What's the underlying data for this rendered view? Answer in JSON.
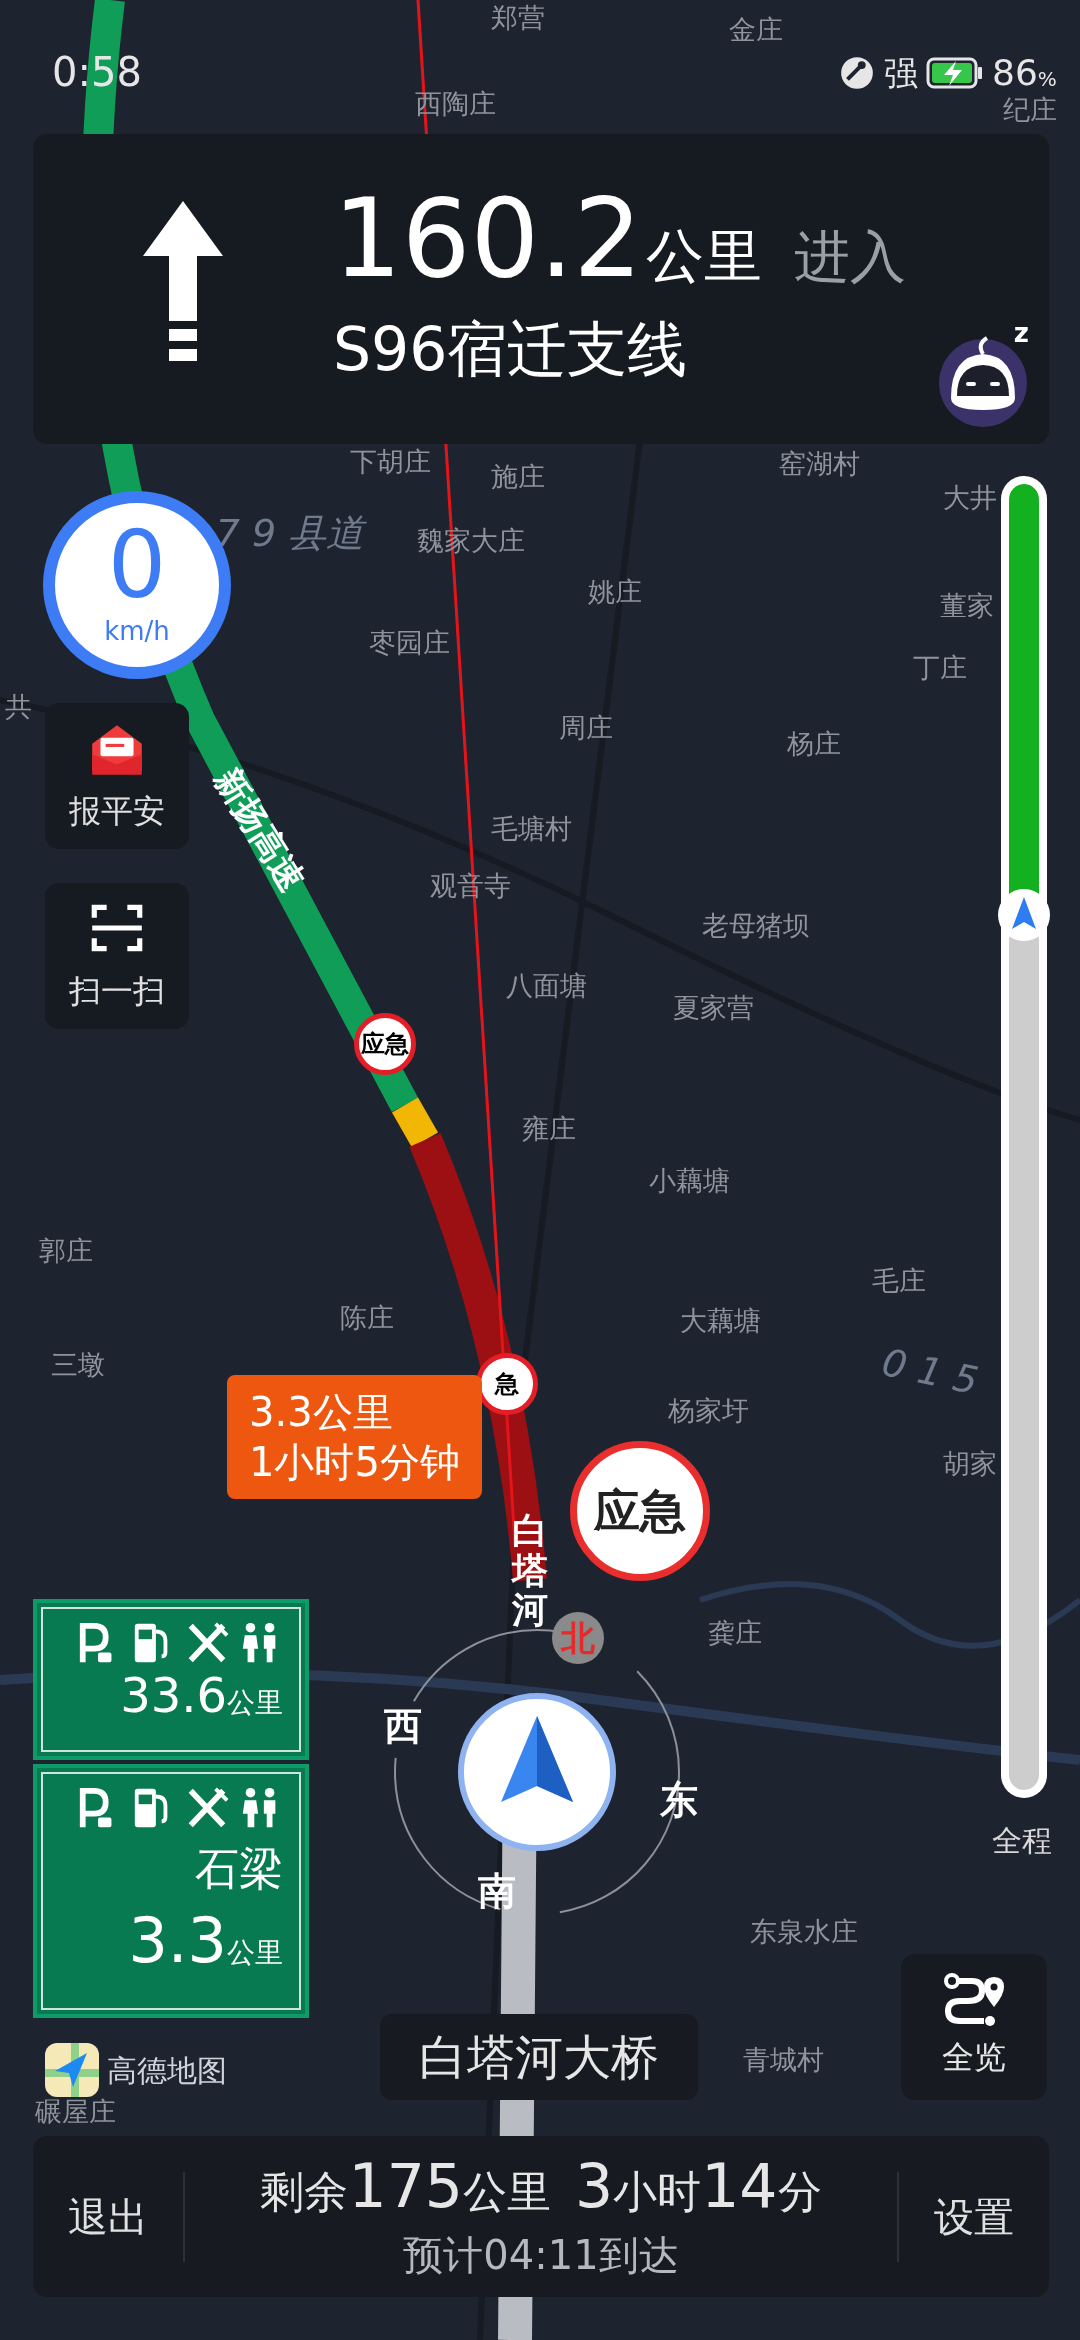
{
  "status_bar": {
    "time": "0:58",
    "signal_label": "强",
    "battery_value": "86",
    "battery_unit": "%",
    "charging": true
  },
  "guidance": {
    "arrow": {
      "kind": "straight"
    },
    "distance": "160.2",
    "unit": "公里",
    "action": "进入",
    "road": "S96宿迁支线",
    "assistant_badge": "z"
  },
  "speed": {
    "value": "0",
    "unit": "km/h"
  },
  "side_buttons": [
    {
      "kind": "safety",
      "label": "报平安"
    },
    {
      "kind": "scan",
      "label": "扫一扫"
    }
  ],
  "map_labels": [
    {
      "text": "郑营",
      "kind": "place"
    },
    {
      "text": "金庄",
      "kind": "place"
    },
    {
      "text": "西陶庄",
      "kind": "place"
    },
    {
      "text": "纪庄",
      "kind": "place"
    },
    {
      "text": "下胡庄",
      "kind": "place"
    },
    {
      "text": "施庄",
      "kind": "place"
    },
    {
      "text": "窑湖村",
      "kind": "place"
    },
    {
      "text": "大井",
      "kind": "place"
    },
    {
      "text": "7 9 县道",
      "kind": "road"
    },
    {
      "text": "魏家大庄",
      "kind": "place"
    },
    {
      "text": "姚庄",
      "kind": "place"
    },
    {
      "text": "董家",
      "kind": "place"
    },
    {
      "text": "枣园庄",
      "kind": "place"
    },
    {
      "text": "丁庄",
      "kind": "place"
    },
    {
      "text": "共",
      "kind": "place"
    },
    {
      "text": "周庄",
      "kind": "place"
    },
    {
      "text": "杨庄",
      "kind": "place"
    },
    {
      "text": "毛塘村",
      "kind": "place"
    },
    {
      "text": "观音寺",
      "kind": "place"
    },
    {
      "text": "老母猪坝",
      "kind": "place"
    },
    {
      "text": "八面塘",
      "kind": "place"
    },
    {
      "text": "夏家营",
      "kind": "place"
    },
    {
      "text": "雍庄",
      "kind": "place"
    },
    {
      "text": "小藕塘",
      "kind": "place"
    },
    {
      "text": "郭庄",
      "kind": "place"
    },
    {
      "text": "毛庄",
      "kind": "place"
    },
    {
      "text": "陈庄",
      "kind": "place"
    },
    {
      "text": "大藕塘",
      "kind": "place"
    },
    {
      "text": "三墩",
      "kind": "place"
    },
    {
      "text": "0 1 5",
      "kind": "road"
    },
    {
      "text": "杨家圩",
      "kind": "place"
    },
    {
      "text": "胡家",
      "kind": "place"
    },
    {
      "text": "龚庄",
      "kind": "place"
    },
    {
      "text": "东泉水庄",
      "kind": "place"
    },
    {
      "text": "青城村",
      "kind": "place"
    },
    {
      "text": "碾屋庄",
      "kind": "place"
    }
  ],
  "route_labels": [
    {
      "text": "新扬高速",
      "kind": "slanted"
    },
    {
      "text": "白塔河",
      "kind": "vertical"
    }
  ],
  "route_progress": {
    "level": 0.33,
    "label": "全程"
  },
  "emergency_markers": [
    {
      "text": "应急"
    },
    {
      "text": "急"
    }
  ],
  "traffic_bubble": {
    "distance": "3.3公里",
    "duration": "1小时5分钟"
  },
  "emergency_bubble": {
    "text": "应急"
  },
  "compass": {
    "north": "北",
    "west": "西",
    "east": "东",
    "south": "南"
  },
  "service_areas": [
    {
      "facilities": [
        {
          "kind": "parking"
        },
        {
          "kind": "fuel"
        },
        {
          "kind": "food"
        },
        {
          "kind": "restroom"
        }
      ],
      "distance": "33.6",
      "unit": "公里"
    },
    {
      "facilities": [
        {
          "kind": "parking"
        },
        {
          "kind": "fuel"
        },
        {
          "kind": "food"
        },
        {
          "kind": "restroom"
        }
      ],
      "name": "石梁",
      "distance": "3.3",
      "unit": "公里"
    }
  ],
  "brand": "高德地图",
  "current_road": "白塔河大桥",
  "overview_button": {
    "label": "全览"
  },
  "bottom_bar": {
    "exit": "退出",
    "remaining_distance": [
      {
        "text": "剩余",
        "kind": "small"
      },
      {
        "text": "175",
        "kind": "big"
      },
      {
        "text": "公里",
        "kind": "small"
      }
    ],
    "remaining_time": [
      {
        "text": "3",
        "kind": "big"
      },
      {
        "text": "小时",
        "kind": "small"
      },
      {
        "text": "14",
        "kind": "big"
      },
      {
        "text": "分",
        "kind": "small"
      }
    ],
    "eta": "预计04:11到达",
    "settings": "设置"
  }
}
